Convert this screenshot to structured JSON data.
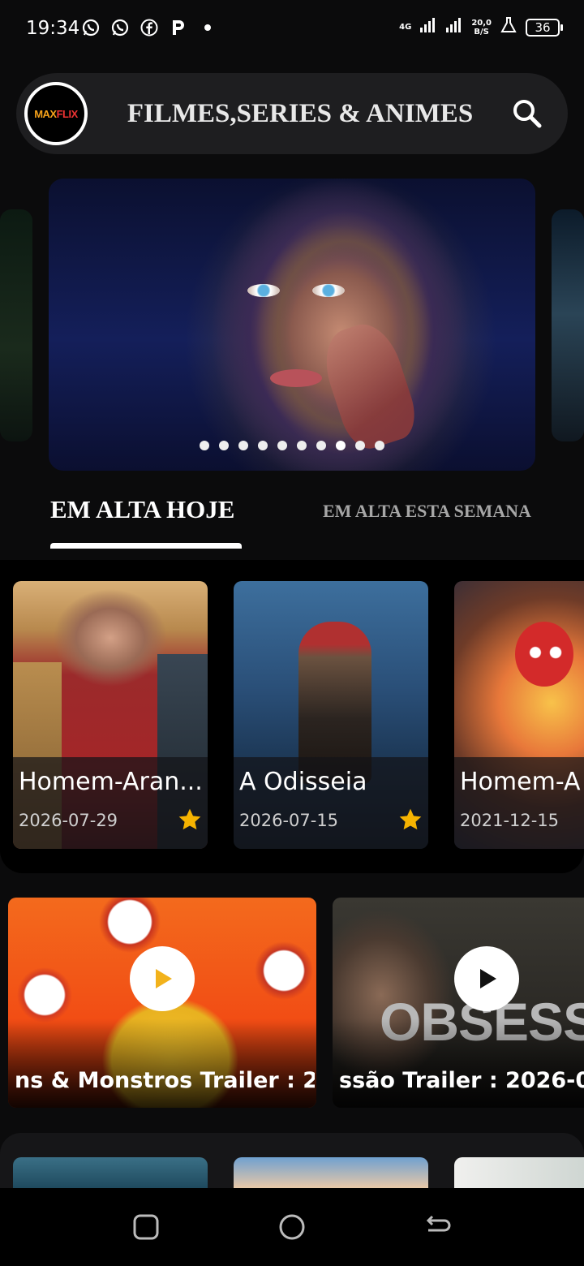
{
  "status_bar": {
    "time": "19:34",
    "network": "4G",
    "speed_value": "20,0",
    "speed_unit": "B/S",
    "battery": "36",
    "notification_icons": [
      "whatsapp-icon",
      "whatsapp-icon",
      "facebook-icon",
      "p-icon",
      "dot-icon"
    ]
  },
  "header": {
    "logo_text_a": "MAX",
    "logo_text_b": "FLIX",
    "title": "FILMES,SERIES & ANIMES",
    "search_icon": "search-icon"
  },
  "carousel": {
    "slide_count": 10,
    "active_index": 7
  },
  "tabs": [
    {
      "label": "EM ALTA HOJE",
      "selected": true
    },
    {
      "label": "EM ALTA ESTA SEMANA",
      "selected": false
    }
  ],
  "trending": [
    {
      "title": "Homem-Aran...",
      "date": "2026-07-29",
      "starred": true
    },
    {
      "title": "A Odisseia",
      "date": "2026-07-15",
      "starred": true
    },
    {
      "title": "Homem-A",
      "date": "2021-12-15",
      "starred": false
    }
  ],
  "trailers": [
    {
      "title": "ns & Monstros Trailer : 2"
    },
    {
      "title": "ssão Trailer : 2026-0",
      "poster_word": "OBSESSÃO"
    }
  ],
  "nav": {
    "recents_icon": "square-icon",
    "home_icon": "circle-icon",
    "back_icon": "back-icon"
  },
  "colors": {
    "background": "#0b0b0c",
    "header_pill": "#1e1e20",
    "star": "#f5b301",
    "tab_inactive": "#a6a6a6"
  }
}
